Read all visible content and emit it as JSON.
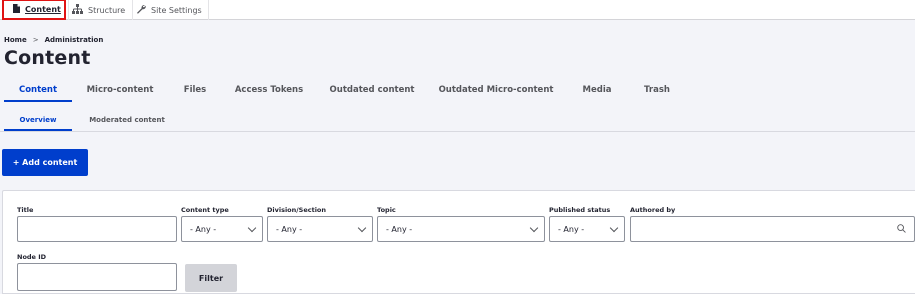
{
  "toolbar": {
    "content_label": "Content",
    "structure_label": "Structure",
    "settings_label": "Site Settings"
  },
  "breadcrumb": {
    "home": "Home",
    "separator": ">",
    "administration": "Administration"
  },
  "page": {
    "title": "Content"
  },
  "tabs": [
    {
      "label": "Content",
      "active": true
    },
    {
      "label": "Micro-content"
    },
    {
      "label": "Files"
    },
    {
      "label": "Access Tokens"
    },
    {
      "label": "Outdated content"
    },
    {
      "label": "Outdated Micro-content"
    },
    {
      "label": "Media"
    },
    {
      "label": "Trash"
    }
  ],
  "subtabs": [
    {
      "label": "Overview",
      "active": true
    },
    {
      "label": "Moderated content"
    }
  ],
  "actions": {
    "add_content": "+ Add content"
  },
  "filters": {
    "title": {
      "label": "Title",
      "value": ""
    },
    "content_type": {
      "label": "Content type",
      "value": "- Any -"
    },
    "division": {
      "label": "Division/Section",
      "value": "- Any -"
    },
    "topic": {
      "label": "Topic",
      "value": "- Any -"
    },
    "published": {
      "label": "Published status",
      "value": "- Any -"
    },
    "authored_by": {
      "label": "Authored by",
      "value": ""
    },
    "node_id": {
      "label": "Node ID",
      "value": ""
    },
    "filter_button": "Filter"
  },
  "colors": {
    "accent": "#003ecc",
    "highlight": "#e01313"
  }
}
